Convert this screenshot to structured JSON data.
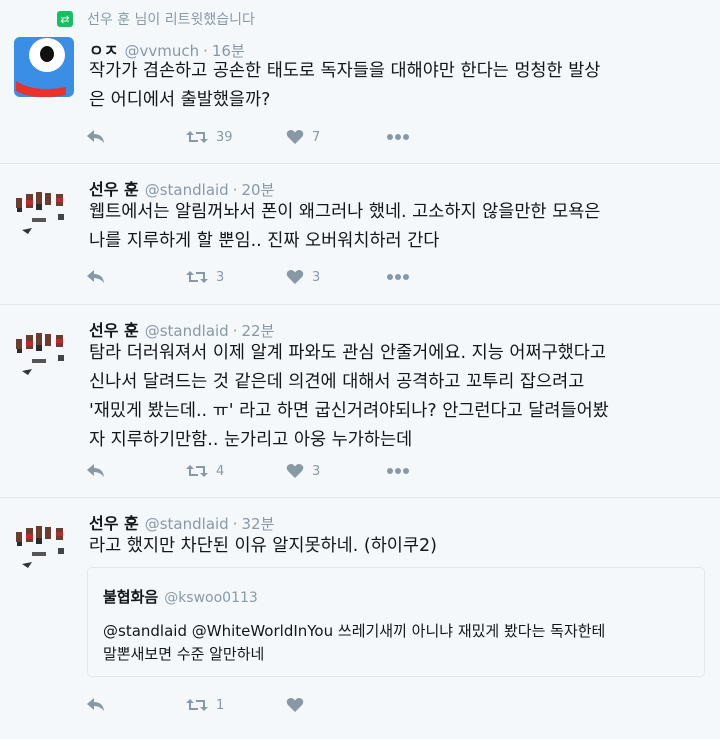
{
  "retweet_banner": {
    "text": "선우 훈 님이 리트윗했습니다"
  },
  "tweets": [
    {
      "name": "ㅇㅈ",
      "handle": "@vvmuch",
      "time": "16분",
      "text_lines": [
        "작가가 겸손하고 공손한 태도로 독자들을 대해야만 한다는 멍청한 발상",
        "은 어디에서 출발했을까?"
      ],
      "retweets": "39",
      "likes": "7"
    },
    {
      "name": "선우 훈",
      "handle": "@standlaid",
      "time": "20분",
      "text_lines": [
        "웹트에서는 알림꺼놔서 폰이 왜그러나 했네. 고소하지 않을만한 모욕은",
        "나를 지루하게 할 뿐임.. 진짜 오버워치하러 간다"
      ],
      "retweets": "3",
      "likes": "3"
    },
    {
      "name": "선우 훈",
      "handle": "@standlaid",
      "time": "22분",
      "text_lines": [
        "탐라 더러워져서 이제 알계 파와도 관심 안줄거에요. 지능 어쩌구했다고",
        "신나서 달려드는 것 같은데 의견에 대해서 공격하고 꼬투리 잡으려고",
        "'재밌게 봤는데.. ㅠ' 라고 하면 굽신거려야되나? 안그런다고 달려들어봤",
        "자 지루하기만함.. 눈가리고 아웅 누가하는데"
      ],
      "retweets": "4",
      "likes": "3"
    },
    {
      "name": "선우 훈",
      "handle": "@standlaid",
      "time": "32분",
      "text_lines": [
        "라고 했지만 차단된 이유 알지못하네. (하이쿠2)"
      ],
      "retweets": "1",
      "likes": "",
      "quote": {
        "name": "불협화음",
        "handle": "@kswoo0113",
        "text_lines": [
          "@standlaid @WhiteWorldInYou 쓰레기새끼 아니냐 재밌게 봤다는 독자한테",
          "말뽄새보면 수준 알만하네"
        ]
      }
    }
  ],
  "colors": {
    "muted": "#8899a6",
    "retweet_green": "#17bf63",
    "border": "#e1e8ed",
    "avatar_blue": "#3a8ee6"
  }
}
